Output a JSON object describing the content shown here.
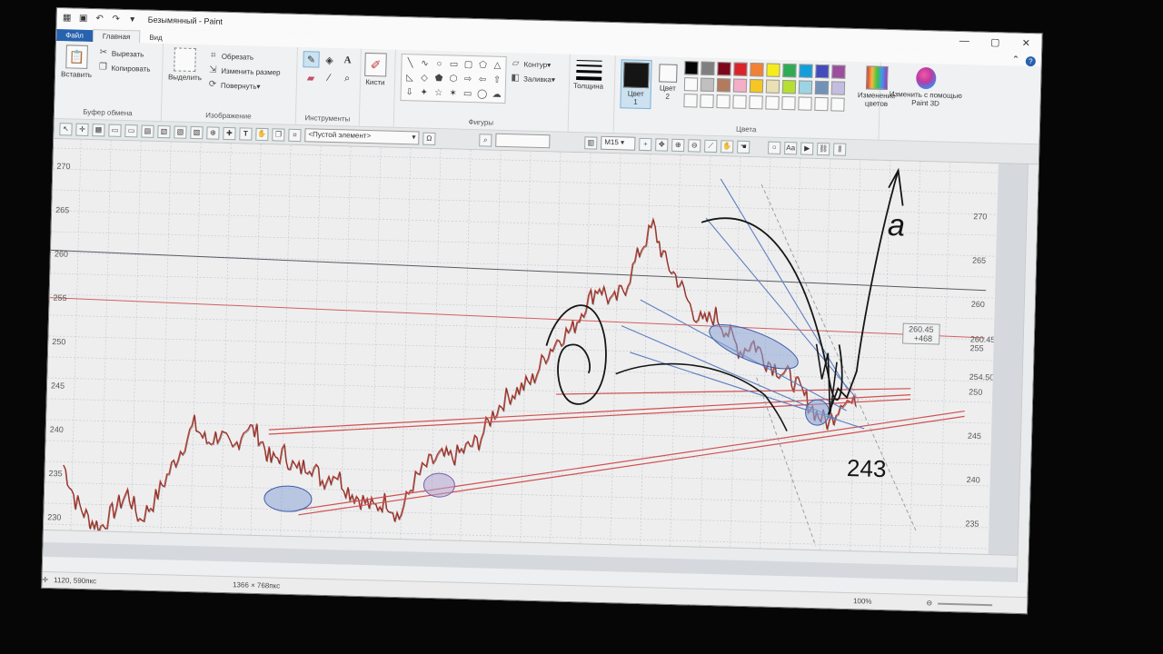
{
  "window": {
    "title": "Безымянный - Paint"
  },
  "tabs": [
    {
      "label": "Файл"
    },
    {
      "label": "Главная"
    },
    {
      "label": "Вид"
    }
  ],
  "ribbon": {
    "clipboard": {
      "paste": "Вставить",
      "cut": "Вырезать",
      "copy": "Копировать",
      "group": "Буфер обмена"
    },
    "image": {
      "select": "Выделить",
      "crop": "Обрезать",
      "resize": "Изменить размер",
      "rotate": "Повернуть",
      "group": "Изображение"
    },
    "tools": {
      "group": "Инструменты"
    },
    "brushes": {
      "label": "Кисти"
    },
    "shapes": {
      "outline": "Контур",
      "fill": "Заливка",
      "group": "Фигуры"
    },
    "size": {
      "label": "Толщина"
    },
    "color1": {
      "label": "Цвет 1",
      "color": "#111111"
    },
    "color2": {
      "label": "Цвет 2",
      "color": "#ffffff"
    },
    "colors": {
      "group": "Цвета",
      "edit": "Изменение цветов"
    },
    "paint3d": {
      "label": "Изменить с помощью Paint 3D"
    },
    "palette": [
      "#000000",
      "#7f7f7f",
      "#880015",
      "#ed1c24",
      "#ff7f27",
      "#fff200",
      "#22b14c",
      "#00a2e8",
      "#3f48cc",
      "#a349a4",
      "#ffffff",
      "#c3c3c3",
      "#b97a57",
      "#ffaec9",
      "#ffc90e",
      "#efe4b0",
      "#b5e61d",
      "#99d9ea",
      "#7092be",
      "#c8bfe7",
      "#ffffff",
      "#ffffff",
      "#ffffff",
      "#ffffff",
      "#ffffff",
      "#ffffff",
      "#ffffff",
      "#ffffff",
      "#ffffff",
      "#ffffff"
    ]
  },
  "chart_toolbar": {
    "element": "<Пустой элемент>",
    "timeframe": "M15"
  },
  "chart": {
    "left_axis": [
      "270",
      "265",
      "260",
      "255",
      "250",
      "245",
      "240",
      "235",
      "230"
    ],
    "right_axis": [
      "270",
      "265",
      "260",
      "255",
      "250",
      "245",
      "240",
      "235",
      "230"
    ],
    "price_badges": [
      "260.45",
      "254.50"
    ],
    "label_box": [
      "260.45",
      "+468"
    ],
    "annotation_number": "243",
    "annotation_letter": "a"
  },
  "chart_data": {
    "type": "line",
    "ylabel": "",
    "xlabel": "",
    "ylim": [
      229,
      271
    ],
    "series": [
      {
        "values": [
          236,
          232,
          230,
          229,
          231,
          233,
          230,
          232,
          235,
          238,
          241,
          239,
          240,
          238,
          241,
          240,
          237,
          238,
          236,
          237,
          235,
          236,
          234,
          233,
          232,
          233,
          231,
          235,
          237,
          238,
          238,
          239,
          240,
          243,
          245,
          246,
          247,
          250,
          252,
          253,
          256,
          258,
          256,
          258,
          262,
          265,
          261,
          259,
          256,
          254,
          255,
          253,
          251,
          252,
          250,
          249,
          248,
          246,
          244,
          243,
          246,
          245
        ]
      }
    ]
  },
  "statusbar": {
    "position": "1120, 590пкс",
    "size": "1366 × 768пкс",
    "zoom": "100%"
  }
}
